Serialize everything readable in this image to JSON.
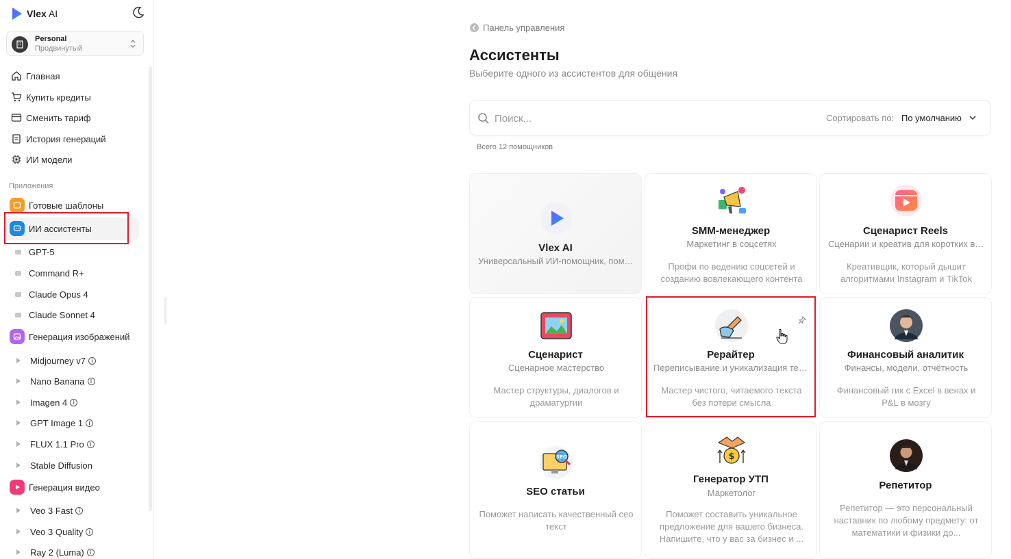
{
  "app": {
    "name": "Vlex",
    "name_suffix": " AI"
  },
  "workspace": {
    "name": "Personal",
    "plan": "Продвинутый"
  },
  "nav": [
    {
      "label": "Главная",
      "icon": "home-icon"
    },
    {
      "label": "Купить кредиты",
      "icon": "cart-icon"
    },
    {
      "label": "Сменить тариф",
      "icon": "card-icon"
    },
    {
      "label": "История генераций",
      "icon": "history-icon"
    },
    {
      "label": "ИИ модели",
      "icon": "chip-icon"
    }
  ],
  "apps_section_label": "Приложения",
  "apps": {
    "templates": "Готовые шаблоны",
    "assistants": "ИИ ассистенты",
    "assistant_models": [
      "GPT-5",
      "Command R+",
      "Claude Opus 4",
      "Claude Sonnet 4"
    ],
    "image_gen": "Генерация изображений",
    "image_models": [
      "Midjourney v7",
      "Nano Banana",
      "Imagen 4",
      "GPT Image 1",
      "FLUX 1.1 Pro",
      "Stable Diffusion"
    ],
    "video_gen": "Генерация видео",
    "video_models": [
      "Veo 3 Fast",
      "Veo 3 Quality",
      "Ray 2 (Luma)"
    ],
    "info_glyph": "i"
  },
  "colors": {
    "accent": "#2e6cf6",
    "templates_icon": "#f59b2a",
    "assistants_icon": "#1e88e5",
    "image_icon": "#b266f0",
    "video_icon": "#ef3b77",
    "highlight": "#e0192b"
  },
  "main": {
    "breadcrumb": "Панель управления",
    "title": "Ассистенты",
    "subtitle": "Выберите одного из ассистентов для общения",
    "search_placeholder": "Поиск...",
    "sort_label": "Сортировать по:",
    "sort_value": "По умолчанию",
    "total": "Всего 12 помощников"
  },
  "assistants": [
    {
      "title": "Vlex AI",
      "subtitle": "Универсальный ИИ-помощник, помогающий с любыми задачами",
      "desc": "",
      "icon": "vlex-logo-icon"
    },
    {
      "title": "SMM-менеджер",
      "subtitle": "Маркетинг в соцсетях",
      "desc": "Профи по ведению соцсетей и созданию вовлекающего контента",
      "icon": "megaphone-icon"
    },
    {
      "title": "Сценарист Reels",
      "subtitle": "Сценарии и креатив для коротких видео",
      "desc": "Креативщик, который дышит алгоритмами Instagram и TikTok",
      "icon": "reels-icon"
    },
    {
      "title": "Сценарист",
      "subtitle": "Сценарное мастерство",
      "desc": "Мастер структуры, диалогов и драматургии",
      "icon": "theater-icon"
    },
    {
      "title": "Рерайтер",
      "subtitle": "Переписывание и уникализация текстов",
      "desc": "Мастер чистого, читаемого текста без потери смысла",
      "icon": "writing-hand-icon"
    },
    {
      "title": "Финансовый аналитик",
      "subtitle": "Финансы, модели, отчётность",
      "desc": "Финансовый гик с Excel в венах и P&L в мозгу",
      "icon": "analyst-avatar-icon"
    },
    {
      "title": "SEO статьи",
      "subtitle": "",
      "desc": "Поможет написать качественный сео текст",
      "icon": "seo-monitor-icon"
    },
    {
      "title": "Генератор УТП",
      "subtitle": "Маркетолог",
      "desc": "Поможет составить уникальное предложение для вашего бизнеса. Напишите, что у вас за бизнес и ...",
      "icon": "money-handshake-icon"
    },
    {
      "title": "Репетитор",
      "subtitle": "",
      "desc": "Репетитор — это персональный наставник по любому предмету: от математики и физики до...",
      "icon": "tutor-avatar-icon"
    }
  ]
}
